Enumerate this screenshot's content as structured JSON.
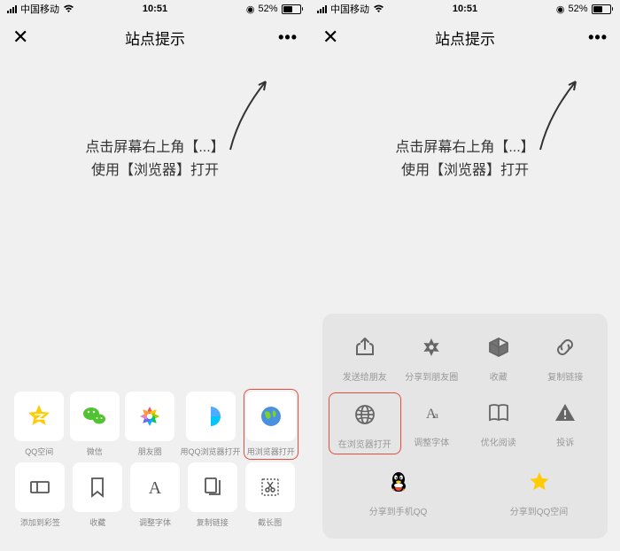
{
  "status": {
    "carrier": "中国移动",
    "time": "10:51",
    "battery_pct": "52%"
  },
  "header": {
    "title": "站点提示",
    "close": "✕",
    "more": "•••"
  },
  "instruction": {
    "line1": "点击屏幕右上角【...】",
    "line2": "使用【浏览器】打开"
  },
  "left_sheet": {
    "row1": [
      {
        "label": "QQ空间",
        "icon": "qzone"
      },
      {
        "label": "微信",
        "icon": "wechat"
      },
      {
        "label": "朋友圈",
        "icon": "moments"
      },
      {
        "label": "用QQ浏览器打开",
        "icon": "qqbrowser"
      },
      {
        "label": "用浏览器打开",
        "icon": "globe",
        "hl": true
      }
    ],
    "row2": [
      {
        "label": "添加到彩签",
        "icon": "rect"
      },
      {
        "label": "收藏",
        "icon": "bookmark"
      },
      {
        "label": "调整字体",
        "icon": "font"
      },
      {
        "label": "复制链接",
        "icon": "copy"
      },
      {
        "label": "截长图",
        "icon": "scissors"
      }
    ]
  },
  "right_sheet": {
    "row1": [
      {
        "label": "发送给朋友",
        "icon": "share"
      },
      {
        "label": "分享到朋友圈",
        "icon": "moments-gray"
      },
      {
        "label": "收藏",
        "icon": "cube"
      },
      {
        "label": "复制链接",
        "icon": "link"
      }
    ],
    "row2": [
      {
        "label": "在浏览器打开",
        "icon": "globe-gray",
        "hl": true
      },
      {
        "label": "调整字体",
        "icon": "aa"
      },
      {
        "label": "优化阅读",
        "icon": "book"
      },
      {
        "label": "投诉",
        "icon": "warn"
      }
    ],
    "row3": [
      {
        "label": "分享到手机QQ",
        "icon": "qq"
      },
      {
        "label": "分享到QQ空间",
        "icon": "qzone-star"
      }
    ]
  }
}
